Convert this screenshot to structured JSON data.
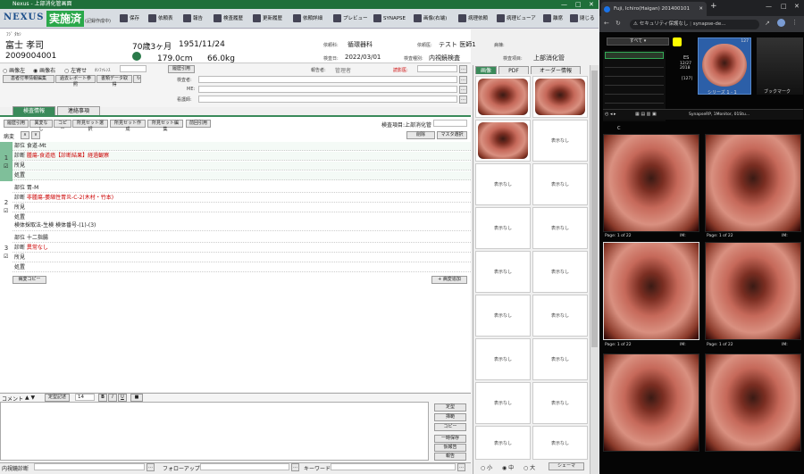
{
  "window": {
    "title": "Nexus - 上部消化管画面",
    "minimize": "—",
    "maximize": "□",
    "close": "✕"
  },
  "toolbar": {
    "logo": "NEXUS",
    "status": "実施済",
    "status_sub": "(記録作成中)",
    "buttons": [
      "保存",
      "依頼表",
      "報告",
      "検査履歴",
      "更新履歴",
      "依頼詳細",
      "プレビュー",
      "SYNAPSE",
      "画像(右端)",
      "病理依頼",
      "病理ビューア",
      "離席",
      "閉じる"
    ]
  },
  "patient": {
    "kana": "ﾌｼﾞ ﾀｶｼ",
    "name": "富士 孝司",
    "id": "2009004001",
    "age": "70歳3ヶ月",
    "dob": "1951/11/24",
    "height": "179.0cm",
    "weight": "66.0kg",
    "dept_label": "依頼科:",
    "dept": "循環器科",
    "requester_label": "依頼医:",
    "requester": "テスト 医師1",
    "ward_label": "病棟:",
    "exam_date_label": "検査日:",
    "exam_date": "2022/03/01",
    "exam_type_label": "検査種別:",
    "exam_type": "内視鏡検査",
    "exam_item_label": "検査項目:",
    "exam_item": "上部消化管"
  },
  "options": {
    "img_left": "画像左",
    "img_right": "画像右",
    "left_align": "左寄せ",
    "conference_label": "ｶﾝﾌｧﾚﾝｽ",
    "history_btn": "履歴引用",
    "reporter_label": "報告者:",
    "reporter": "管理者",
    "approver_label": "読影医:",
    "examiner_label": "検査者:",
    "me_label": "ME:",
    "nurse_label": "看護師:",
    "ref_edit_btn": "患者付帯情報編集",
    "prev_report_btn": "過去レポート参照",
    "paper_btn": "書類データ取得",
    "reload_btn": "↻"
  },
  "tabs": [
    "検査情報",
    "連絡事項"
  ],
  "findings_toolbar": {
    "buttons": [
      "履歴引用",
      "異変なし",
      "コピー",
      "所見セット選択",
      "所見セット作成",
      "所見セット編集",
      "前回引用"
    ],
    "exam_item_label": "検査項目:上部消化管",
    "delete_btn": "削除",
    "master_btn": "マスタ選択",
    "disease_label": "病変",
    "up": "∧",
    "down": "∨"
  },
  "findings": [
    {
      "index": "1",
      "site_label": "部位",
      "site": "食道-Mt",
      "diag_label": "診断",
      "diag": "腫瘍-食道癌【診断結果】経過観察",
      "finding_label": "所見",
      "treatment_label": "処置",
      "treatment": ""
    },
    {
      "index": "2",
      "site_label": "部位",
      "site": "胃-M",
      "diag_label": "診断",
      "diag": "非腫瘍-萎縮性胃炎-C-2(木村・竹本)",
      "finding_label": "所見",
      "treatment_label": "処置",
      "treatment": "検体採取法-生検 検体番号-(1)-(3)"
    },
    {
      "index": "3",
      "site_label": "部位",
      "site": "十二指腸",
      "diag_label": "診断",
      "diag": "異常なし",
      "finding_label": "所見",
      "treatment_label": "処置",
      "treatment": ""
    }
  ],
  "findings_bottom": {
    "copy_btn": "病変コピー",
    "add_btn": "+ 病変追加"
  },
  "editor": {
    "comment_label": "コメント",
    "up_down": "▲ ▼",
    "phrase_btn": "定型記述",
    "font_size": "14",
    "bold": "B",
    "italic": "I",
    "underline": "U",
    "color": "■",
    "side_buttons": [
      "定型",
      "挿範",
      "コピー",
      "一時保存",
      "仮報告",
      "報告"
    ]
  },
  "footer": {
    "diag_label": "内視鏡診断",
    "followup_label": "フォローアップ",
    "keyword_label": "キーワード"
  },
  "image_panel": {
    "tabs": [
      "画像",
      "PDF",
      "オーダー情報"
    ],
    "no_display": "表示なし",
    "sizes": [
      "小",
      "中",
      "大"
    ],
    "schema_btn": "シェーマ"
  },
  "browser": {
    "tab_title": "Fuji, Ichiro(Haigan) 201400101",
    "new_tab": "+",
    "security": "セキュリティ保護なし",
    "url": "synapse-de...",
    "viewer": {
      "all_label": "すべて",
      "series_label": "シリーズ 1 - 1",
      "bookmark_label": "ブックマーク",
      "es_label": "ES",
      "es_date": "12/27 2018",
      "es_count": "[127]",
      "thumb_count": "127",
      "toolbar_text": "SynapseRP, 1Monitor, 01Stu...",
      "c_label": "C",
      "page_label": "Page: 1 of 22",
      "im_label": "IM:"
    }
  },
  "colors": {
    "accent_green": "#2aa84a",
    "title_green": "#1f6f3a",
    "diag_red": "#cc0000"
  }
}
